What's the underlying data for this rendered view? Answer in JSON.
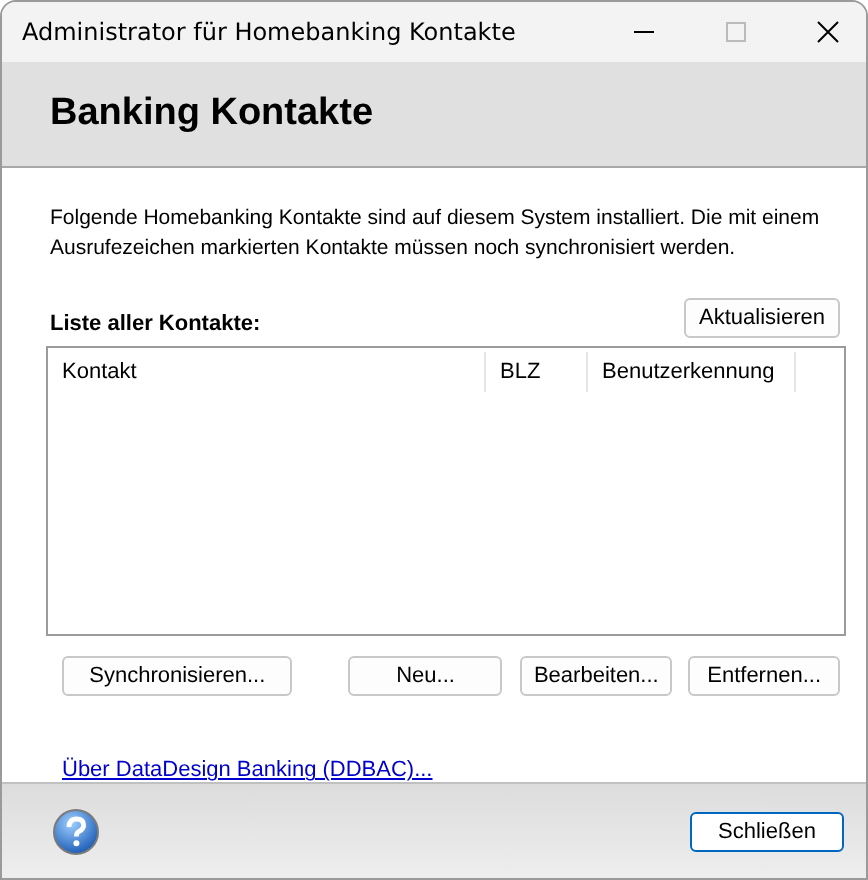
{
  "window": {
    "title": "Administrator für Homebanking Kontakte"
  },
  "header": {
    "title": "Banking Kontakte"
  },
  "description": "Folgende Homebanking Kontakte sind auf diesem System installiert. Die mit einem Ausrufezeichen markierten Kontakte müssen noch synchronisiert werden.",
  "list_label": "Liste aller Kontakte:",
  "refresh_button": "Aktualisieren",
  "table": {
    "columns": [
      "Kontakt",
      "BLZ",
      "Benutzerkennung"
    ]
  },
  "buttons": [
    {
      "label": "Synchronisieren..."
    },
    {
      "label": "Neu..."
    },
    {
      "label": "Bearbeiten..."
    },
    {
      "label": "Entfernen..."
    }
  ],
  "about_link": "Über DataDesign Banking (DDBAC)...",
  "close_button": "Schließen"
}
